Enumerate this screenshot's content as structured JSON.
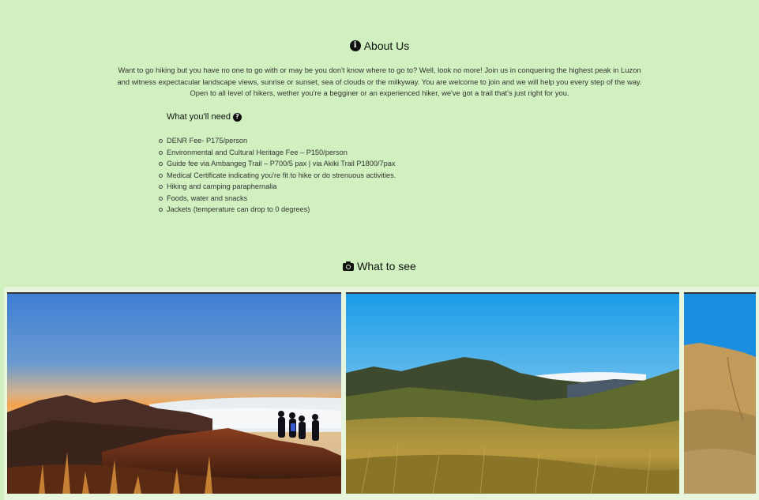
{
  "about": {
    "icon": "info-circle-icon",
    "title": "About Us",
    "intro": "Want to go hiking but you have no one to go with or may be you don't know where to go to? Well, look no more! Join us in conquering the highest peak in Luzon and witness expectacular landscape views, sunrise or sunset, sea of clouds or the milkyway. You are welcome to join and we will help you every step of the way. Open to all level of hikers, wether you're a begginer or an experienced hiker, we've got a trail that's just right for you."
  },
  "needs": {
    "title": "What you'll need",
    "icon": "question-circle-icon",
    "items": [
      "DENR Fee- P175/person",
      "Environmental and Cultural Heritage Fee – P150/person",
      "Guide fee via Ambangeg Trail – P700/5 pax | via Akiki Trail P1800/7pax",
      "Medical Certificate indicating you're fit to hike or do strenuous activities.",
      "Hiking and camping paraphernalia",
      "Foods, water and snacks",
      "Jackets (temperature can drop to 0 degrees)"
    ]
  },
  "gallery": {
    "icon": "camera-icon",
    "title": "What to see",
    "photos": [
      "sunrise-sea-of-clouds-hikers",
      "grassy-ridge-blue-sky",
      "golden-grass-slope"
    ]
  }
}
